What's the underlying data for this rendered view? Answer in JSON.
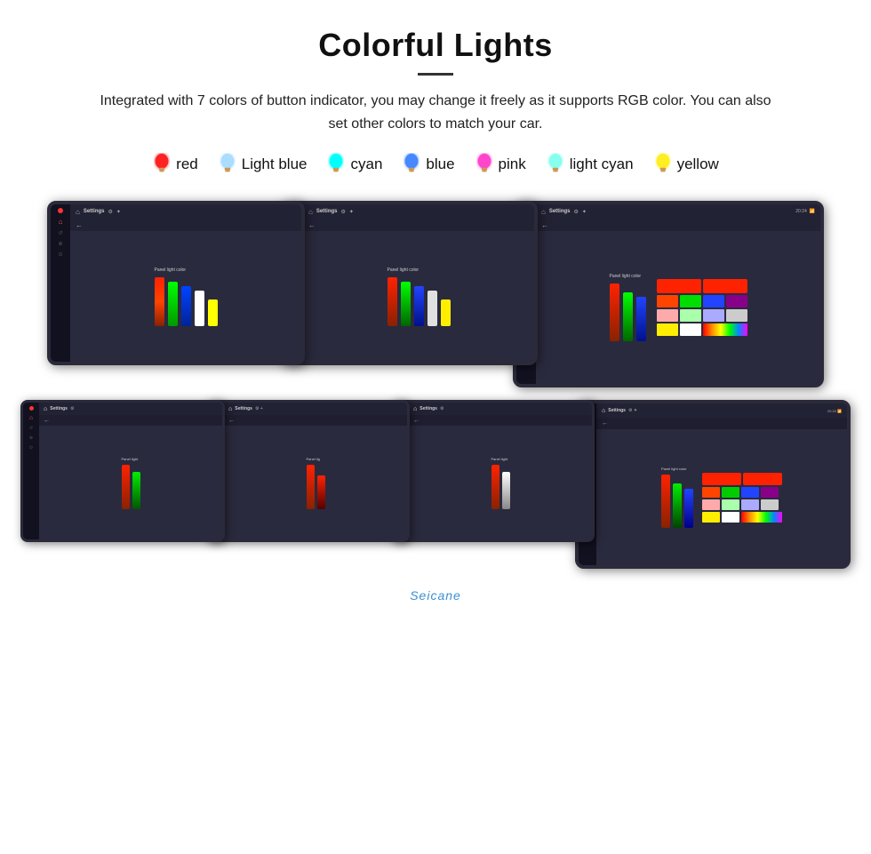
{
  "header": {
    "title": "Colorful Lights",
    "subtitle": "Integrated with 7 colors of button indicator, you may change it freely as it supports RGB color. You can also set other colors to match your car."
  },
  "colors": [
    {
      "name": "red",
      "color": "#ff2222",
      "glow": "#ff4444"
    },
    {
      "name": "Light blue",
      "color": "#99ccff",
      "glow": "#aaddff"
    },
    {
      "name": "cyan",
      "color": "#00ffff",
      "glow": "#44ffff"
    },
    {
      "name": "blue",
      "color": "#3366ff",
      "glow": "#5588ff"
    },
    {
      "name": "pink",
      "color": "#ff44cc",
      "glow": "#ff66dd"
    },
    {
      "name": "light cyan",
      "color": "#88ffee",
      "glow": "#aaffee"
    },
    {
      "name": "yellow",
      "color": "#ffee22",
      "glow": "#ffff44"
    }
  ],
  "screens": {
    "topbar_label": "Settings",
    "panel_label": "Panel light color"
  },
  "watermark": "Seicane"
}
